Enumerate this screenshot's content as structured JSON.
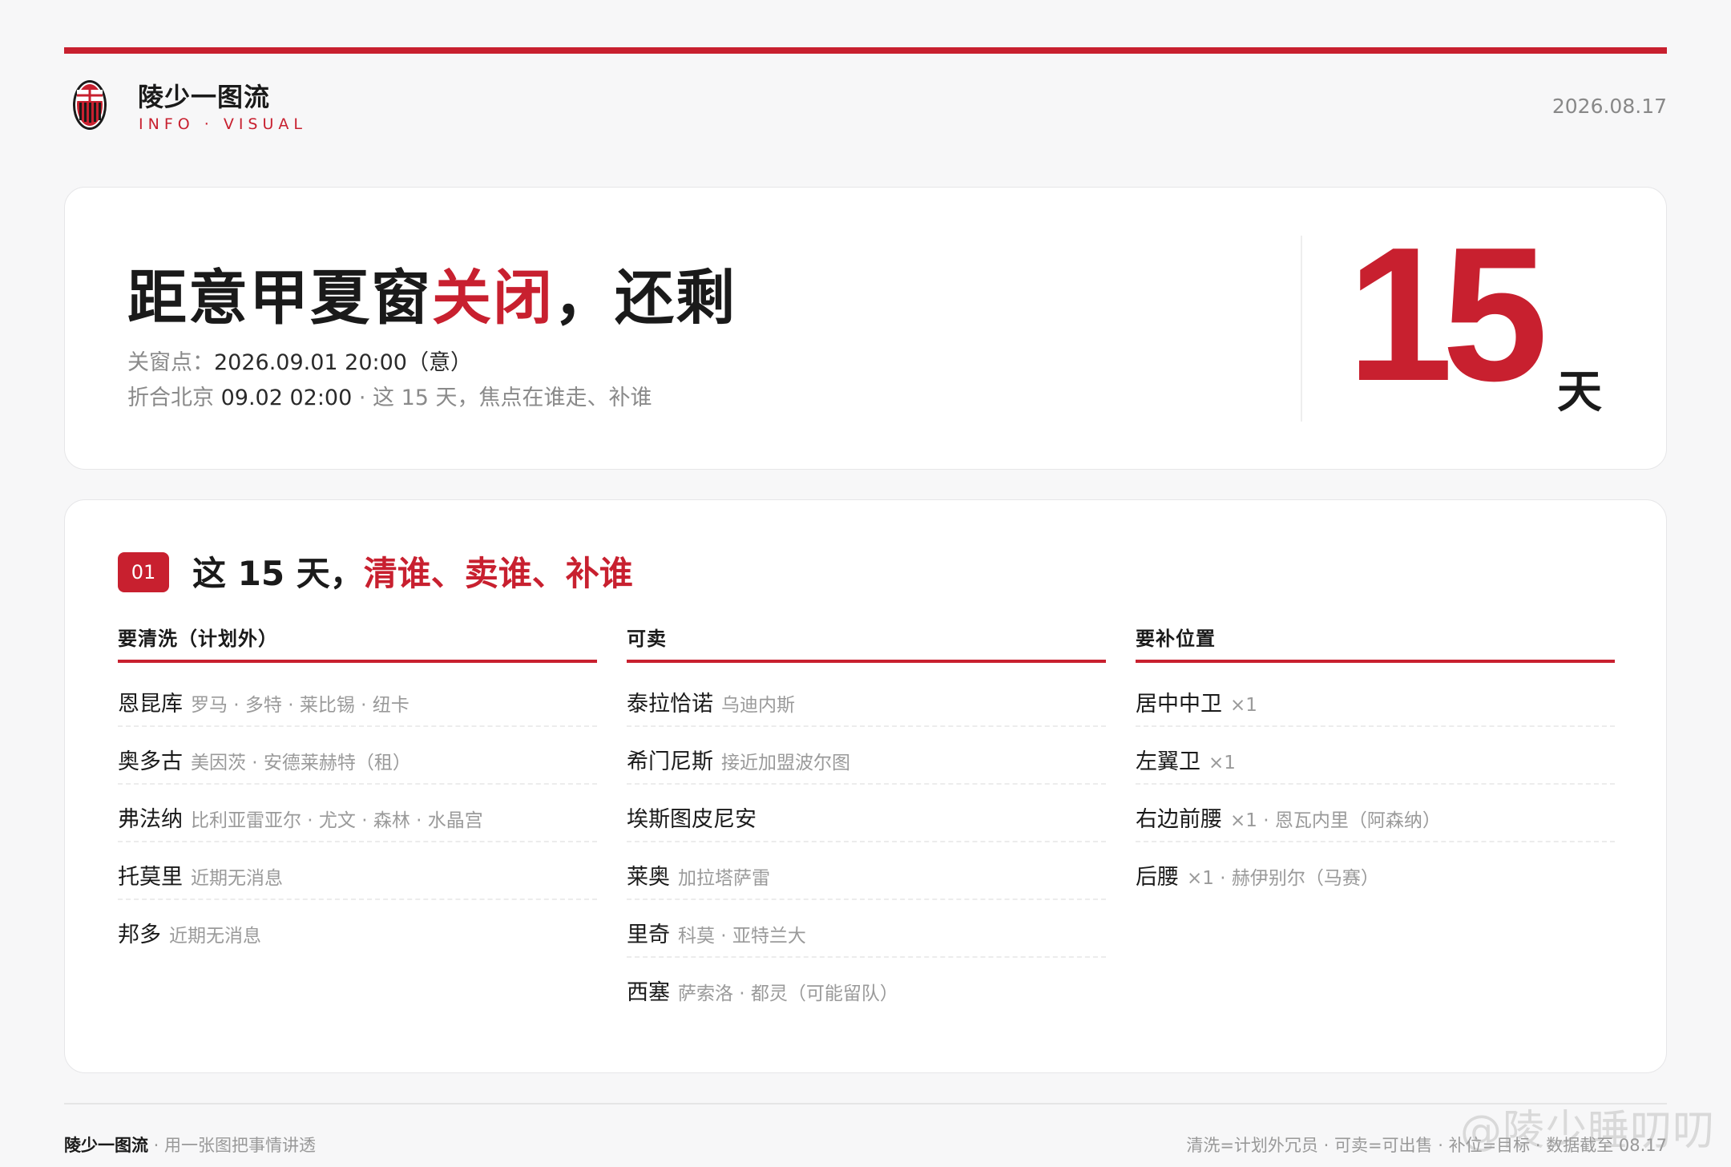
{
  "accent_color": "#c8202f",
  "header": {
    "brand_title": "陵少一图流",
    "brand_sub": "INFO · VISUAL",
    "date": "2026.08.17",
    "logo_icon": "ac-milan-crest-icon"
  },
  "hero": {
    "title_prefix": "距意甲夏窗",
    "title_highlight": "关闭",
    "title_suffix": "，还剩",
    "line1_label": "关窗点：",
    "line1_value": "2026.09.01 20:00（意）",
    "line2_label": "折合北京 ",
    "line2_value": "09.02 02:00",
    "line2_tail": " · 这 15 天，焦点在谁走、补谁",
    "countdown_value": "15",
    "countdown_unit": "天"
  },
  "section": {
    "badge": "01",
    "title_prefix": "这 15 天，",
    "title_highlight": "清谁、卖谁、补谁"
  },
  "columns": [
    {
      "header": "要清洗（计划外）",
      "rows": [
        {
          "name": "恩昆库",
          "detail": "罗马 · 多特 · 莱比锡 · 纽卡"
        },
        {
          "name": "奥多古",
          "detail": "美因茨 · 安德莱赫特（租）"
        },
        {
          "name": "弗法纳",
          "detail": "比利亚雷亚尔 · 尤文 · 森林 · 水晶宫"
        },
        {
          "name": "托莫里",
          "detail": "近期无消息"
        },
        {
          "name": "邦多",
          "detail": "近期无消息"
        }
      ]
    },
    {
      "header": "可卖",
      "rows": [
        {
          "name": "泰拉恰诺",
          "detail": "乌迪内斯"
        },
        {
          "name": "希门尼斯",
          "detail": "接近加盟波尔图"
        },
        {
          "name": "埃斯图皮尼安",
          "detail": ""
        },
        {
          "name": "莱奥",
          "detail": "加拉塔萨雷"
        },
        {
          "name": "里奇",
          "detail": "科莫 · 亚特兰大"
        },
        {
          "name": "西塞",
          "detail": "萨索洛 · 都灵（可能留队）"
        }
      ]
    },
    {
      "header": "要补位置",
      "rows": [
        {
          "name": "居中中卫",
          "detail": "×1"
        },
        {
          "name": "左翼卫",
          "detail": "×1"
        },
        {
          "name": "右边前腰",
          "detail": "×1 · 恩瓦内里（阿森纳）"
        },
        {
          "name": "后腰",
          "detail": "×1 · 赫伊别尔（马赛）"
        }
      ]
    }
  ],
  "footer": {
    "brand": "陵少一图流",
    "tagline": " · 用一张图把事情讲透",
    "legend": "清洗=计划外冗员 · 可卖=可出售 · 补位=目标 · 数据截至 08.17",
    "watermark": "@陵少睡叨叨"
  }
}
